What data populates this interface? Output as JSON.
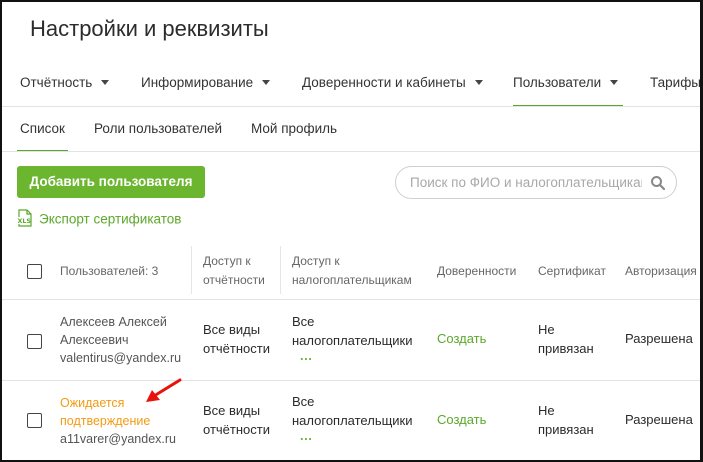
{
  "page": {
    "title": "Настройки и реквизиты"
  },
  "main_nav": {
    "items": [
      {
        "label": "Отчётность",
        "has_caret": true,
        "active": false
      },
      {
        "label": "Информирование",
        "has_caret": true,
        "active": false
      },
      {
        "label": "Доверенности и кабинеты",
        "has_caret": true,
        "active": false
      },
      {
        "label": "Пользователи",
        "has_caret": true,
        "active": true
      },
      {
        "label": "Тарифы",
        "has_caret": false,
        "active": false
      }
    ]
  },
  "sub_nav": {
    "items": [
      {
        "label": "Список",
        "active": true
      },
      {
        "label": "Роли пользователей",
        "active": false
      },
      {
        "label": "Мой профиль",
        "active": false
      }
    ]
  },
  "toolbar": {
    "add_user_label": "Добавить пользователя",
    "search_placeholder": "Поиск по ФИО и налогоплательщикам",
    "export_label": "Экспорт сертификатов",
    "export_icon_text": "XLS"
  },
  "table": {
    "headers": {
      "users": "Пользователей: 3",
      "report_access_1": "Доступ к",
      "report_access_2": "отчётности",
      "taxpayer_access_1": "Доступ к",
      "taxpayer_access_2": "налогоплательщикам",
      "proxies": "Доверенности",
      "certificate": "Сертификат",
      "authorization": "Авторизация"
    },
    "rows": [
      {
        "name_1": "Алексеев Алексей",
        "name_2": "Алексеевич",
        "email": "valentirus@yandex.ru",
        "report_access_1": "Все виды",
        "report_access_2": "отчётности",
        "taxpayer_access_1": "Все",
        "taxpayer_access_2": "налогоплательщики",
        "taxpayer_more": "...",
        "proxy_action": "Создать",
        "certificate_1": "Не",
        "certificate_2": "привязан",
        "authorization": "Разрешена"
      },
      {
        "status_1": "Ожидается",
        "status_2": "подтверждение",
        "email": "a11varer@yandex.ru",
        "report_access_1": "Все виды",
        "report_access_2": "отчётности",
        "taxpayer_access_1": "Все",
        "taxpayer_access_2": "налогоплательщики",
        "taxpayer_more": "...",
        "proxy_action": "Создать",
        "certificate_1": "Не",
        "certificate_2": "привязан",
        "authorization": "Разрешена"
      }
    ]
  },
  "colors": {
    "accent_green": "#6bb52f",
    "link_green": "#5ba82a",
    "pending_orange": "#f39b14",
    "annotation_red": "#e8120c"
  },
  "icons": {
    "caret": "chevron-down-icon",
    "search": "search-icon",
    "export": "xls-file-icon",
    "annotation": "red-arrow-icon"
  }
}
